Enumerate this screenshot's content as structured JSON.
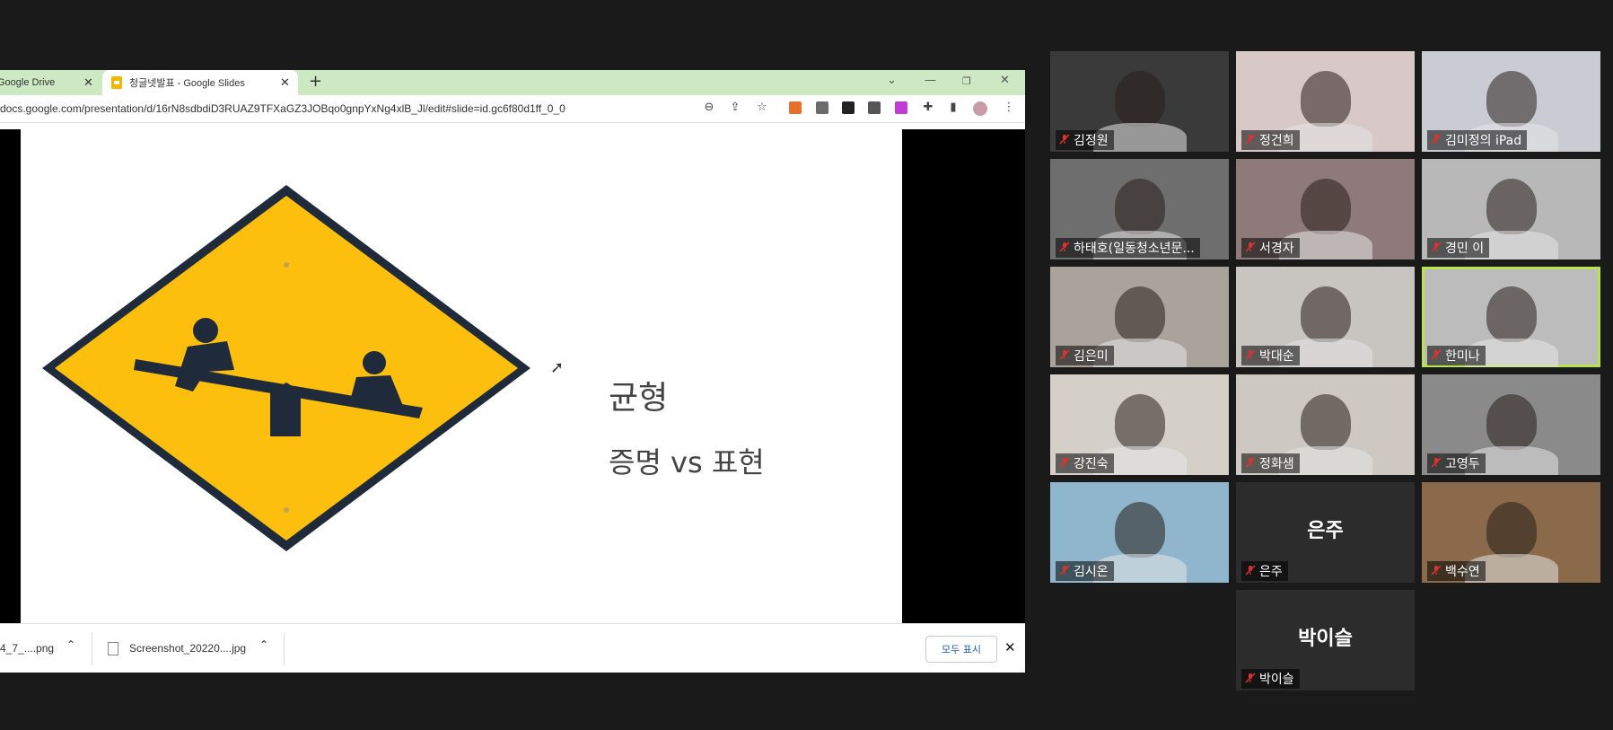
{
  "browser": {
    "tabs": [
      {
        "label": "Google Drive"
      },
      {
        "label": "청글넷발표 - Google Slides"
      }
    ],
    "new_tab": "+",
    "url": "docs.google.com/presentation/d/16rN8sdbdiD3RUAZ9TFXaGZ3JOBqo0gnpYxNg4xlB_Jl/edit#slide=id.gc6f80d1ff_0_0"
  },
  "slide": {
    "title": "균형",
    "subtitle": "증명 vs 표현",
    "sign_color": "#fcbf0e",
    "sign_border": "#1f2b3a"
  },
  "downloads": {
    "items": [
      {
        "label": "4_7_....png"
      },
      {
        "label": "Screenshot_20220....jpg"
      }
    ],
    "show_all": "모두 표시",
    "close": "✕"
  },
  "participants": [
    {
      "name": "김정원",
      "video": true,
      "bg": "#3a3a3a"
    },
    {
      "name": "정건희",
      "video": true,
      "bg": "#d8c8c8"
    },
    {
      "name": "김미정의 iPad",
      "video": true,
      "bg": "#c9ccd2"
    },
    {
      "name": "하태호(일동청소년문...",
      "video": true,
      "bg": "#6e6e6e"
    },
    {
      "name": "서경자",
      "video": true,
      "bg": "#8e7a7a"
    },
    {
      "name": "경민 이",
      "video": true,
      "bg": "#b8b8b8"
    },
    {
      "name": "김은미",
      "video": true,
      "bg": "#a9a39b"
    },
    {
      "name": "박대순",
      "video": true,
      "bg": "#c8c4c0"
    },
    {
      "name": "한미나",
      "video": true,
      "bg": "#bcbcbc",
      "speaking": true
    },
    {
      "name": "강진숙",
      "video": true,
      "bg": "#d4d0c8"
    },
    {
      "name": "정화샘",
      "video": true,
      "bg": "#cdc8c2"
    },
    {
      "name": "고영두",
      "video": true,
      "bg": "#8a8a8a"
    },
    {
      "name": "김시온",
      "video": true,
      "bg": "#8fb6cc"
    },
    {
      "name": "은주",
      "video": false,
      "display": "은주"
    },
    {
      "name": "백수연",
      "video": true,
      "bg": "#8a6a4a"
    },
    {
      "name": "박이슬",
      "video": false,
      "display": "박이슬"
    }
  ],
  "colors": {
    "speaking_outline": "#b8e34a",
    "muted_icon": "#e0322c",
    "tab_strip": "#cde9c4"
  }
}
